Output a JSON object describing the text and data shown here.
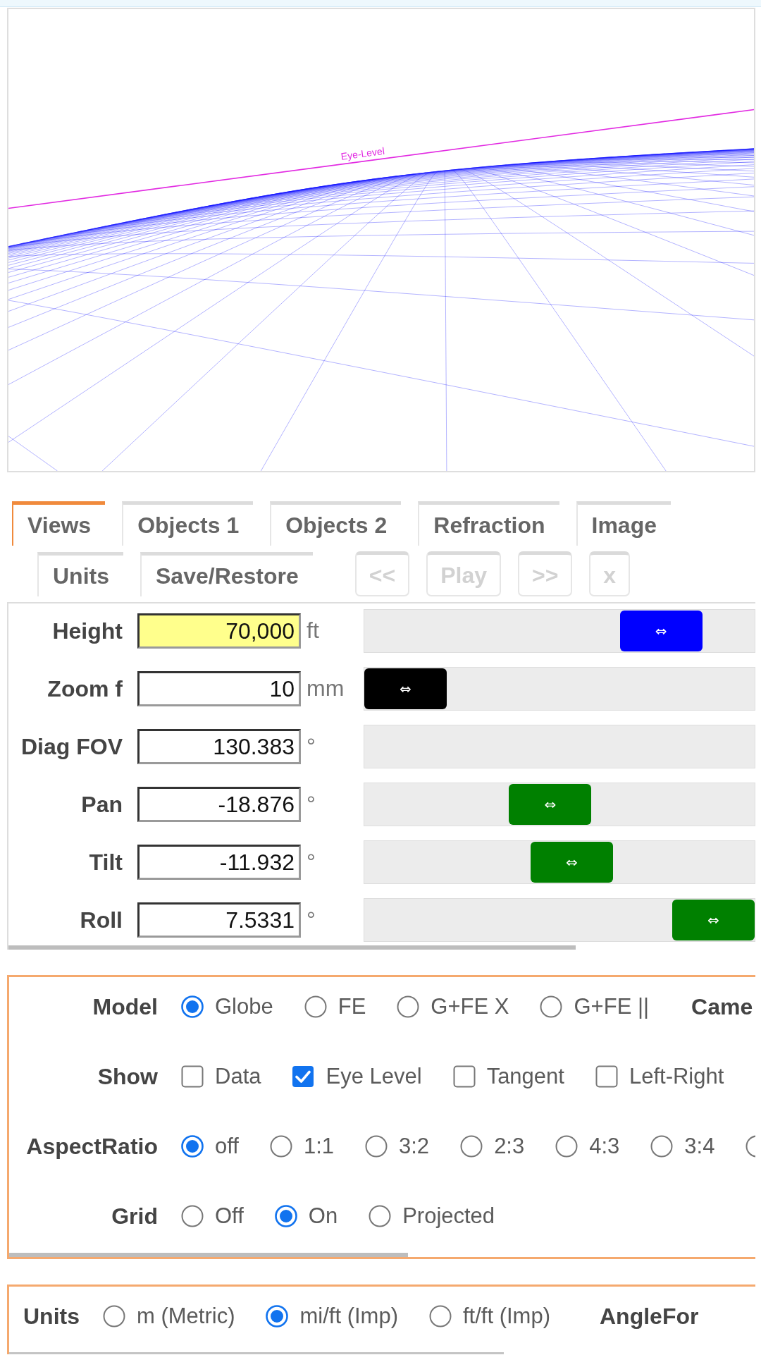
{
  "canvas": {
    "eye_level_label": "Eye-Level"
  },
  "tabs": [
    {
      "label": "Views",
      "selected": true
    },
    {
      "label": "Objects 1",
      "selected": false
    },
    {
      "label": "Objects 2",
      "selected": false
    },
    {
      "label": "Refraction",
      "selected": false
    },
    {
      "label": "Image",
      "selected": false
    },
    {
      "label": "Units",
      "selected": false
    },
    {
      "label": "Save/Restore",
      "selected": false
    }
  ],
  "playback_buttons": [
    {
      "label": "<<",
      "disabled": true
    },
    {
      "label": "Play",
      "disabled": true
    },
    {
      "label": ">>",
      "disabled": true
    },
    {
      "label": "x",
      "disabled": true
    }
  ],
  "view_settings": [
    {
      "label": "Height",
      "value": "70,000",
      "unit": "ft",
      "highlighted": true,
      "level": 0.83,
      "color": "#0000ff",
      "handle": "⇔"
    },
    {
      "label": "Zoom f",
      "value": "10",
      "unit": "mm",
      "highlighted": false,
      "level": 0,
      "color": "#000000",
      "handle": "⇔"
    },
    {
      "label": "Diag FOV",
      "value": "130.383",
      "unit": "°",
      "highlighted": false
    },
    {
      "label": "Pan",
      "value": "-18.876",
      "unit": "°",
      "highlighted": false,
      "level": 0.47,
      "color": "#008000",
      "handle": "⇔"
    },
    {
      "label": "Tilt",
      "value": "-11.932",
      "unit": "°",
      "highlighted": false,
      "level": 0.54,
      "color": "#008000",
      "handle": "⇔"
    },
    {
      "label": "Roll",
      "value": "7.5331",
      "unit": "°",
      "highlighted": false,
      "level": 1,
      "color": "#008000",
      "handle": "⇔"
    }
  ],
  "display_options": [
    {
      "label": "Model",
      "kind": "radio",
      "choices": [
        {
          "label": "Globe",
          "selected": true
        },
        {
          "label": "FE",
          "selected": false
        },
        {
          "label": "G+FE X",
          "selected": false
        },
        {
          "label": "G+FE ||",
          "selected": false
        }
      ],
      "next_label": "Came"
    },
    {
      "label": "Show",
      "kind": "checkbox",
      "choices": [
        {
          "label": "Data",
          "checked": false
        },
        {
          "label": "Eye Level",
          "checked": true
        },
        {
          "label": "Tangent",
          "checked": false
        },
        {
          "label": "Left-Right",
          "checked": false
        }
      ]
    },
    {
      "label": "AspectRatio",
      "kind": "radio",
      "choices": [
        {
          "label": "off",
          "selected": true
        },
        {
          "label": "1:1",
          "selected": false
        },
        {
          "label": "3:2",
          "selected": false
        },
        {
          "label": "2:3",
          "selected": false
        },
        {
          "label": "4:3",
          "selected": false
        },
        {
          "label": "3:4",
          "selected": false
        },
        {
          "selected": false
        }
      ]
    },
    {
      "label": "Grid",
      "kind": "radio",
      "choices": [
        {
          "label": "Off",
          "selected": false
        },
        {
          "label": "On",
          "selected": true
        },
        {
          "label": "Projected",
          "selected": false
        }
      ]
    }
  ],
  "units_options": {
    "label": "Units",
    "kind": "radio",
    "choices": [
      {
        "label": "m (Metric)",
        "selected": false
      },
      {
        "label": "mi/ft (Imp)",
        "selected": true
      },
      {
        "label": "ft/ft (Imp)",
        "selected": false
      }
    ],
    "next_label": "AngleFor"
  }
}
